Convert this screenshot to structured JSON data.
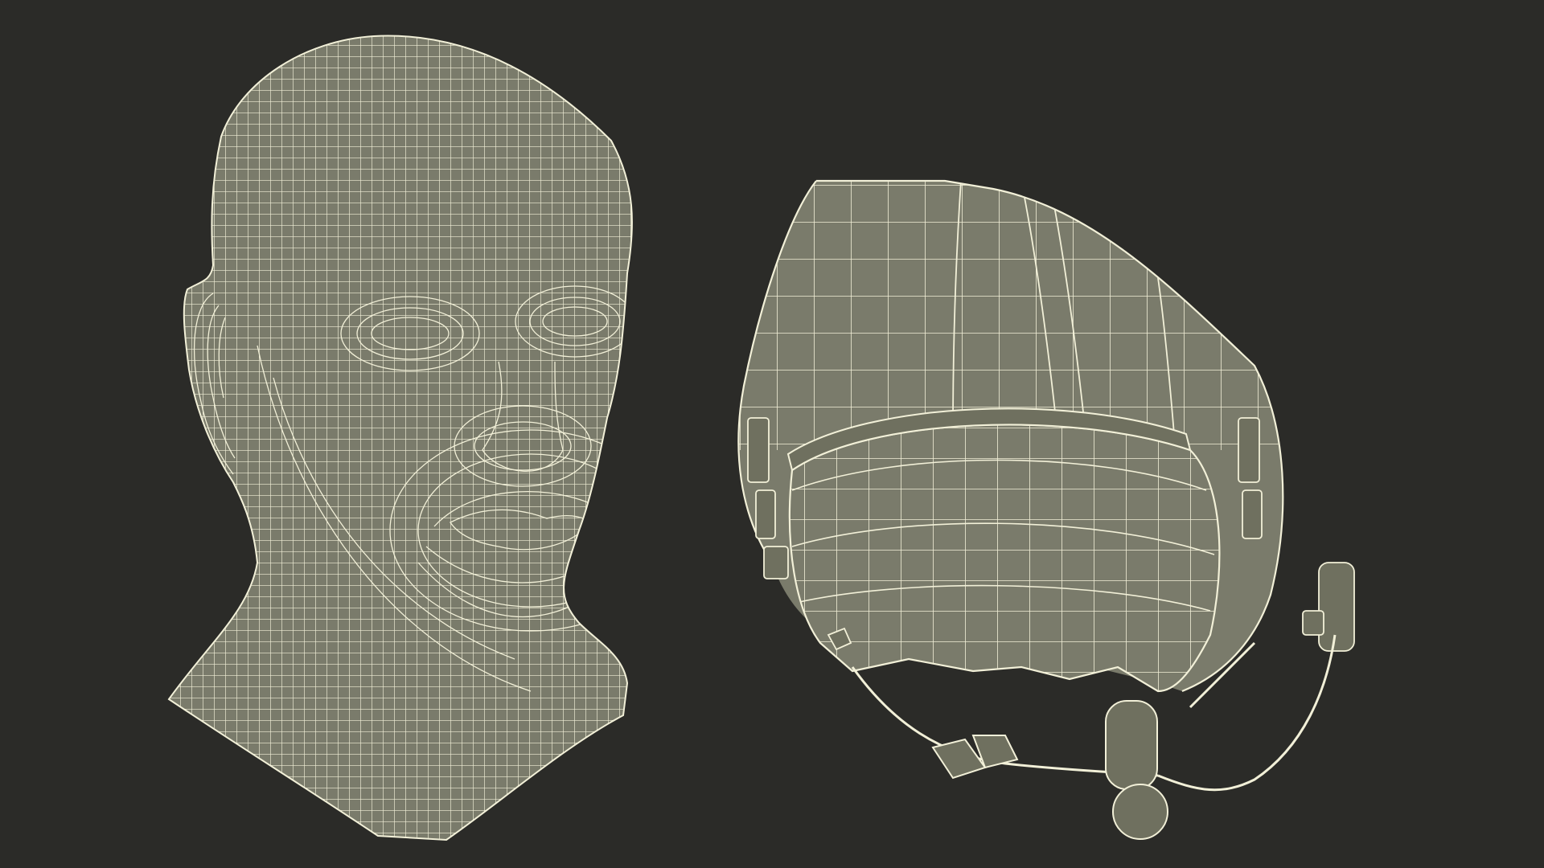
{
  "viewport": {
    "background": "#2b2b28"
  },
  "render": {
    "style": "wireframe",
    "surface_color": "#7a7b6b",
    "wire_color": "#f2f0d8"
  },
  "objects": [
    {
      "name": "human-head",
      "icon": "head-mesh-icon"
    },
    {
      "name": "pilot-helmet",
      "icon": "helmet-mesh-icon"
    }
  ]
}
